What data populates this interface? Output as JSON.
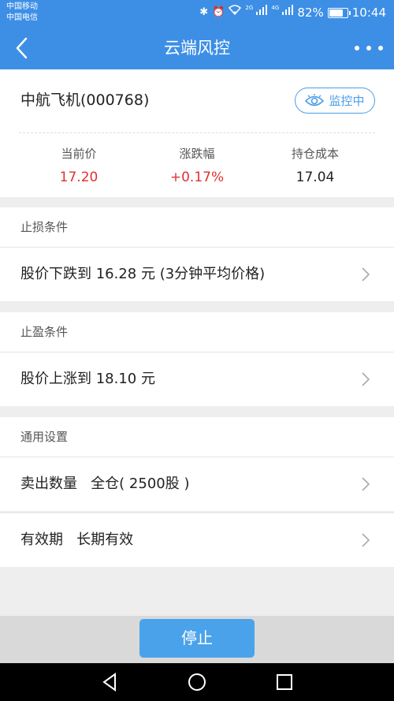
{
  "status_bar": {
    "carrier_1": "中国移动",
    "carrier_2": "中国电信",
    "net_tag_1": "2G",
    "net_tag_2": "4G",
    "battery": "82%",
    "battery_level": 0.82,
    "time": "10:44"
  },
  "nav": {
    "title": "云端风控"
  },
  "stock": {
    "name": "中航飞机(000768)",
    "monitor_label": "监控中",
    "stats": [
      {
        "label": "当前价",
        "value": "17.20"
      },
      {
        "label": "涨跌幅",
        "value": "+0.17%"
      },
      {
        "label": "持仓成本",
        "value": "17.04"
      }
    ]
  },
  "stop_loss": {
    "header": "止损条件",
    "condition": "股价下跌到 16.28 元 (3分钟平均价格)"
  },
  "take_profit": {
    "header": "止盈条件",
    "condition": "股价上涨到 18.10 元"
  },
  "general": {
    "header": "通用设置",
    "sell_qty": "卖出数量   全仓( 2500股 )",
    "validity": "有效期   长期有效"
  },
  "footer": {
    "stop_label": "停止"
  },
  "colors": {
    "header_blue": "#3d8fe6",
    "button_blue": "#4aa3ea",
    "price_red": "#e03030"
  }
}
